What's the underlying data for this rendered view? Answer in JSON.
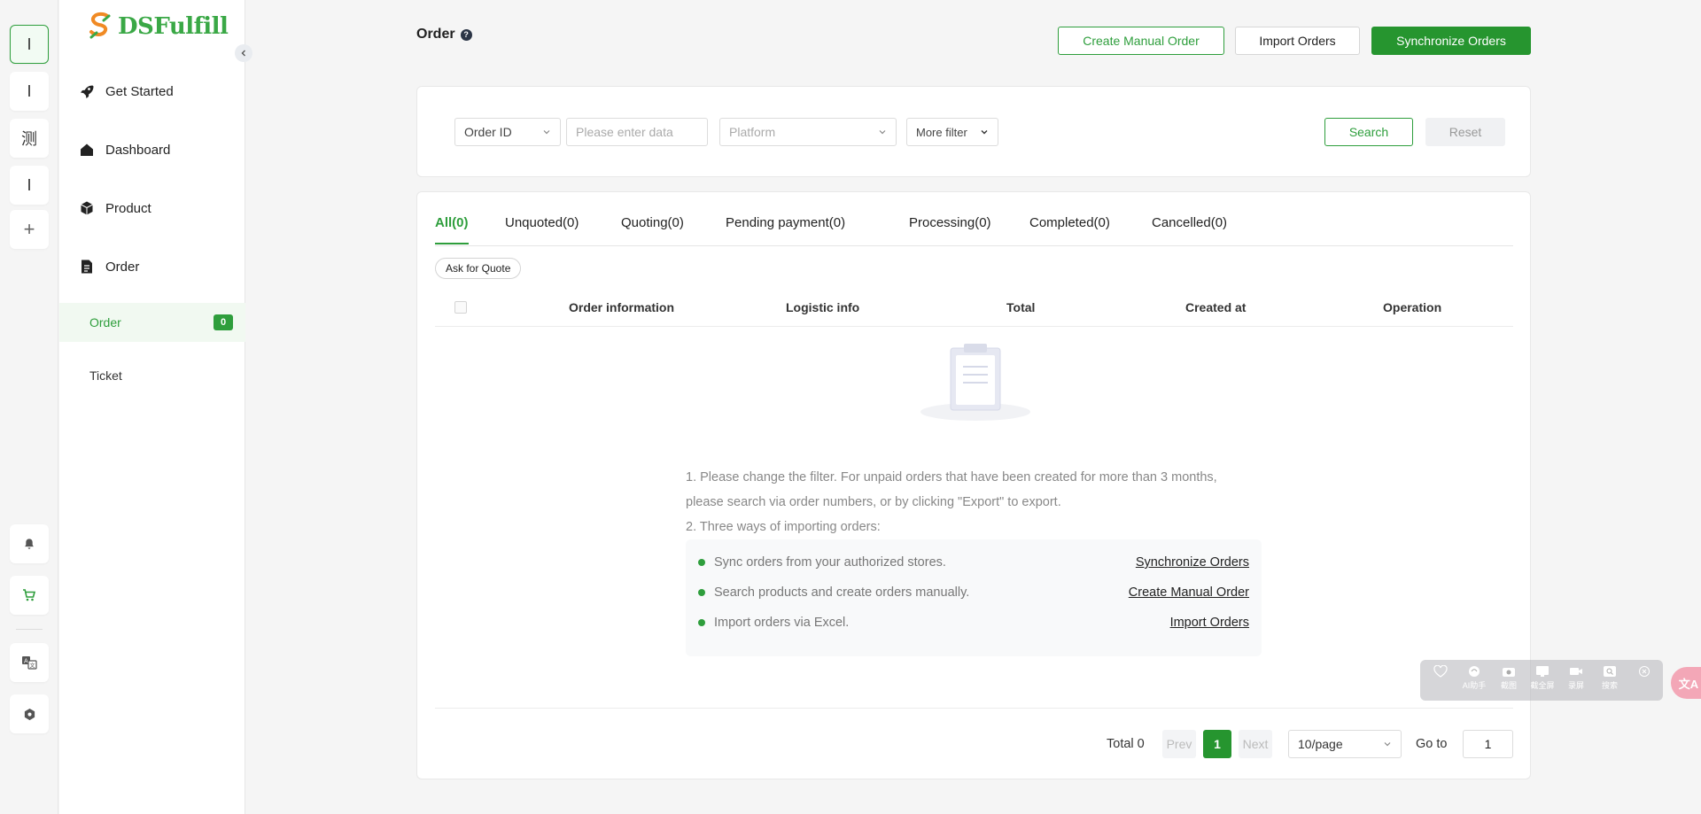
{
  "rail": {
    "items": [
      {
        "label": "I",
        "active": true
      },
      {
        "label": "I",
        "active": false
      },
      {
        "label": "测",
        "active": false
      },
      {
        "label": "I",
        "active": false
      },
      {
        "label": "+",
        "active": false
      }
    ],
    "bottom_icons": [
      "bell-icon",
      "cart-icon",
      "translate-icon",
      "settings-icon"
    ]
  },
  "sidebar": {
    "logo_text": "DSFulfill",
    "nav": [
      {
        "label": "Get Started",
        "icon": "rocket-icon"
      },
      {
        "label": "Dashboard",
        "icon": "home-icon"
      },
      {
        "label": "Product",
        "icon": "box-icon"
      },
      {
        "label": "Order",
        "icon": "document-icon"
      }
    ],
    "sub": [
      {
        "label": "Order",
        "badge": "0",
        "active": true
      },
      {
        "label": "Ticket",
        "active": false
      }
    ]
  },
  "header": {
    "title": "Order",
    "help": "?",
    "buttons": {
      "create_manual": "Create Manual Order",
      "import": "Import Orders",
      "synchronize": "Synchronize Orders"
    }
  },
  "filter": {
    "field_select": "Order ID",
    "data_placeholder": "Please enter data",
    "platform_placeholder": "Platform",
    "more_filter": "More filter",
    "search": "Search",
    "reset": "Reset"
  },
  "tabs": [
    {
      "label": "All(0)",
      "active": true
    },
    {
      "label": "Unquoted(0)"
    },
    {
      "label": "Quoting(0)"
    },
    {
      "label": "Pending payment(0)"
    },
    {
      "label": "Processing(0)"
    },
    {
      "label": "Completed(0)"
    },
    {
      "label": "Cancelled(0)"
    }
  ],
  "ask_for_quote": "Ask for Quote",
  "table": {
    "columns": [
      "Order information",
      "Logistic info",
      "Total",
      "Created at",
      "Operation"
    ]
  },
  "empty": {
    "line1": "1. Please change the filter. For unpaid orders that have been created for more than 3 months,",
    "line2": "please search via order numbers, or by clicking \"Export\" to export.",
    "line3": "2. Three ways of importing orders:",
    "tips": [
      {
        "text": "Sync orders from your authorized stores.",
        "link": "Synchronize Orders"
      },
      {
        "text": "Search products and create orders manually.",
        "link": "Create Manual Order"
      },
      {
        "text": "Import orders via Excel.",
        "link": "Import Orders"
      }
    ]
  },
  "pagination": {
    "total": "Total 0",
    "prev": "Prev",
    "current": "1",
    "next": "Next",
    "page_size": "10/page",
    "goto_label": "Go to",
    "goto_value": "1"
  },
  "floating_toolbar": {
    "items": [
      "AI助手",
      "截图",
      "截全屏",
      "录屏",
      "搜索"
    ],
    "translate": "文A"
  },
  "colors": {
    "accent": "#2e9e3c",
    "accent_solid": "#26952f",
    "sidebar_active_bg": "#f1f9f1"
  }
}
